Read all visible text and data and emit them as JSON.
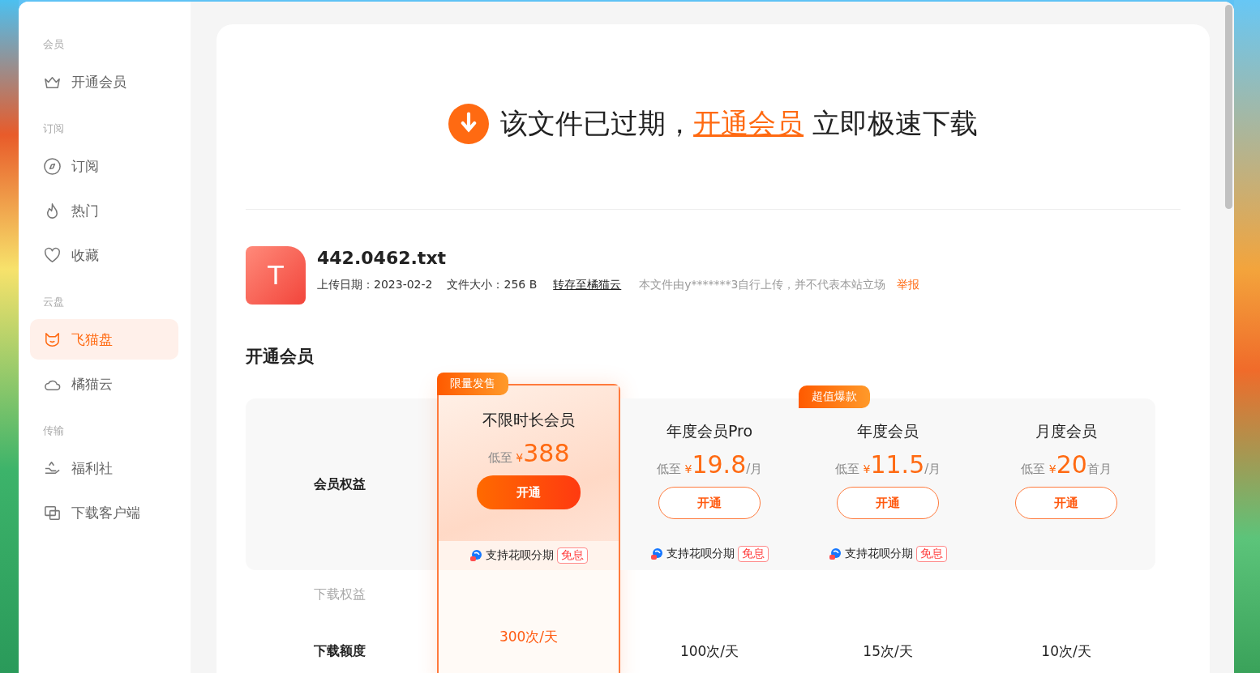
{
  "sidebar": {
    "sections": [
      {
        "heading": "会员",
        "items": [
          {
            "label": "开通会员",
            "selected": false
          }
        ]
      },
      {
        "heading": "订阅",
        "items": [
          {
            "label": "订阅",
            "selected": false
          },
          {
            "label": "热门",
            "selected": false
          },
          {
            "label": "收藏",
            "selected": false
          }
        ]
      },
      {
        "heading": "云盘",
        "items": [
          {
            "label": "飞猫盘",
            "selected": true
          },
          {
            "label": "橘猫云",
            "selected": false
          }
        ]
      },
      {
        "heading": "传输",
        "items": [
          {
            "label": "福利社",
            "selected": false
          },
          {
            "label": "下载客户端",
            "selected": false
          }
        ]
      }
    ]
  },
  "headline": {
    "before": "该文件已过期，",
    "link": "开通会员",
    "after": "立即极速下载"
  },
  "file": {
    "type_glyph": "T",
    "name": "442.0462.txt",
    "upload_date": "上传日期：2023-02-2",
    "size": "文件大小：256 B",
    "save_link": "转存至橘猫云",
    "notice": "本文件由y*******3自行上传，并不代表本站立场",
    "report": "举报"
  },
  "membership": {
    "title": "开通会员",
    "benefits_label": "会员权益",
    "download_section": "下载权益",
    "quota_label": "下载额度",
    "plans": [
      {
        "name": "不限时长会员",
        "badge": "限量发售",
        "featured": true,
        "price_prefix": "低至",
        "currency": "¥",
        "price": "388",
        "button": "开通",
        "installment": "支持花呗分期",
        "installment_tag": "免息",
        "quota": "300次/天"
      },
      {
        "name": "年度会员Pro",
        "featured": false,
        "price_prefix": "低至",
        "currency": "¥",
        "price": "19.8",
        "unit": "/月",
        "button": "开通",
        "installment": "支持花呗分期",
        "installment_tag": "免息",
        "quota": "100次/天"
      },
      {
        "name": "年度会员",
        "badge": "超值爆款",
        "featured": false,
        "price_prefix": "低至",
        "currency": "¥",
        "price": "11.5",
        "unit": "/月",
        "button": "开通",
        "installment": "支持花呗分期",
        "installment_tag": "免息",
        "quota": "15次/天"
      },
      {
        "name": "月度会员",
        "featured": false,
        "price_prefix": "低至",
        "currency": "¥",
        "price": "20",
        "unit": "首月",
        "button": "开通",
        "quota": "10次/天"
      }
    ]
  }
}
